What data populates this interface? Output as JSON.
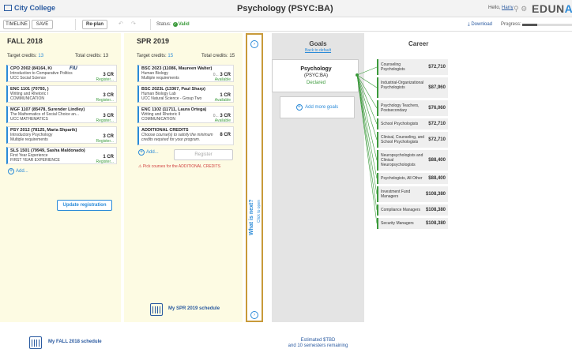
{
  "header": {
    "logo_text": "City College",
    "page_title": "Psychology (PSYC:BA)",
    "hello_prefix": "Hello,",
    "user_name": "Harry",
    "brand_prefix": "EDUN",
    "brand_suffix": "AV"
  },
  "toolbar": {
    "timeline": "TIMELINE",
    "save": "SAVE",
    "replan": "Re-plan",
    "status_label": "Status:",
    "status_value": "Valid",
    "download": "Download",
    "progress_label": "Progress:",
    "progress_fraction": 0.3
  },
  "semesters": [
    {
      "title": "FALL 2018",
      "target_label": "Target credits:",
      "target": "13",
      "total_label": "Total credits:",
      "total": "13",
      "courses": [
        {
          "code": "CPO 2002 (84164, Ki",
          "desc1": "Introduction to Comparative Politics",
          "desc2": "UCC Social Science",
          "credits": "3 CR",
          "status": "Register..."
        },
        {
          "code": "ENC 1101 (70793, )",
          "desc1": "Writing and Rhetoric I",
          "desc2": "COMMUNICATION",
          "credits": "3 CR",
          "status": "Register..."
        },
        {
          "code": "MGF 1107 (85478, Surender Lindley)",
          "desc1": "The Mathematics of Social Choice an...",
          "desc2": "UCC MATHEMATICS",
          "credits": "3 CR",
          "status": "Register..."
        },
        {
          "code": "PSY 2012 (78125, Maria Shparik)",
          "desc1": "Introductory Psychology",
          "desc2": "Multiple requirements",
          "credits": "3 CR",
          "status": "Register..."
        },
        {
          "code": "SLS 1501 (79949, Sasha Maldonado)",
          "desc1": "First Year Experience",
          "desc2": "FIRST YEAR EXPERIENCE",
          "credits": "1 CR",
          "status": "Register..."
        }
      ],
      "add": "Add...",
      "update": "Update registration",
      "schedule": "My FALL 2018 schedule"
    },
    {
      "title": "SPR 2019",
      "target_label": "Target credits:",
      "target": "15",
      "total_label": "Total credits:",
      "total": "15",
      "courses": [
        {
          "code": "BSC 2023 (11086, Maureen Walter)",
          "desc1": "Human Biology",
          "desc2": "Multiple requirements",
          "credits": "3 CR",
          "status": "Available",
          "prefix": "0..."
        },
        {
          "code": "BSC 2023L (13367, Paul Sharp)",
          "desc1": "Human Biology Lab",
          "desc2": "UCC Natural Science - Group Two",
          "credits": "1 CR",
          "status": "Available"
        },
        {
          "code": "ENC 1102 (11711, Laura Ortega)",
          "desc1": "Writing and Rhetoric II",
          "desc2": "COMMUNICATION",
          "credits": "3 CR",
          "status": "Available",
          "prefix": "0..."
        }
      ],
      "additional": {
        "code": "ADDITIONAL CREDITS",
        "desc1": "Choose course(s) to satisfy the minimum",
        "desc2": "credits required for your program.",
        "credits": "8 CR"
      },
      "add": "Add...",
      "register": "Register",
      "warning": "Pick courses for the ADDITIONAL CREDITS",
      "schedule": "My SPR 2019 schedule"
    }
  ],
  "next_panel": {
    "title": "What is next?",
    "subtitle": "Click to open"
  },
  "goals": {
    "heading": "Goals",
    "back": "Back to default",
    "goal_name": "Psychology",
    "goal_code": "(PSYC:BA)",
    "goal_status": "Declared",
    "add_more": "Add more goals",
    "estimate_line1": "Estimated $TBD",
    "estimate_line2": "and 10 semesters remaining"
  },
  "career": {
    "heading": "Career",
    "items": [
      {
        "name": "Counseling Psychologists",
        "salary": "$72,710"
      },
      {
        "name": "Industrial-Organizational Psychologists",
        "salary": "$87,960"
      },
      {
        "name": "Psychology Teachers, Postsecondary",
        "salary": "$76,060"
      },
      {
        "name": "School Psychologists",
        "salary": "$72,710"
      },
      {
        "name": "Clinical, Counseling, and School Psychologists",
        "salary": "$72,710"
      },
      {
        "name": "Neuropsychologists and Clinical Neuropsychologists",
        "salary": "$88,400"
      },
      {
        "name": "Psychologists, All Other",
        "salary": "$88,400"
      },
      {
        "name": "Investment Fund Managers",
        "salary": "$108,380"
      },
      {
        "name": "Compliance Managers",
        "salary": "$108,380"
      },
      {
        "name": "Security Managers",
        "salary": "$108,380"
      }
    ]
  },
  "colors": {
    "accent": "#2a8ad8",
    "valid": "#3a9a3a",
    "semester_bg": "#fdfbe3",
    "next_border": "#c89a3a"
  }
}
